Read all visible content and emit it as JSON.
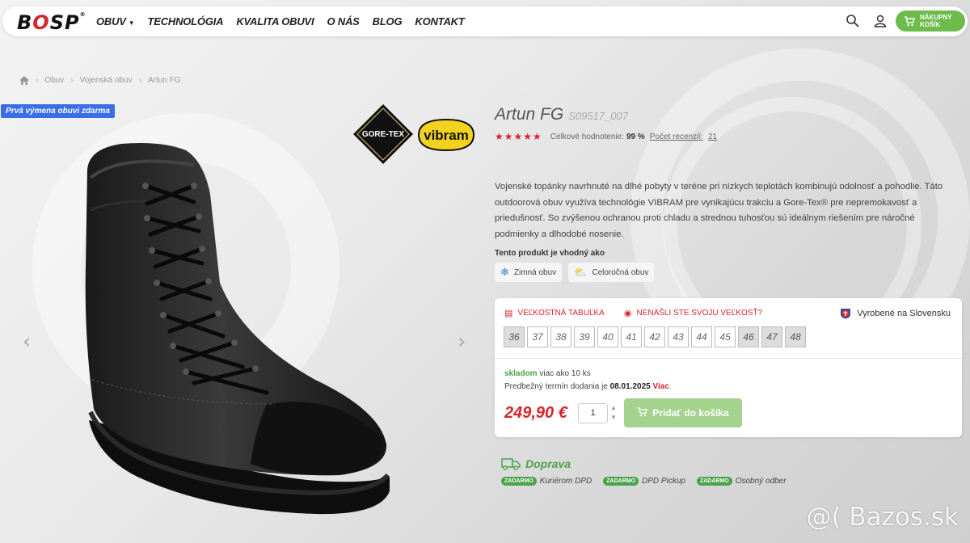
{
  "header": {
    "logo": "BOSP",
    "nav": [
      "OBUV",
      "TECHNOLÓGIA",
      "KVALITA OBUVI",
      "O NÁS",
      "BLOG",
      "KONTAKT"
    ],
    "cart_label_line1": "NÁKUPNÝ",
    "cart_label_line2": "KOŠÍK",
    "icons": [
      "search-icon",
      "user-icon",
      "cart-icon"
    ]
  },
  "breadcrumb": [
    "Obuv",
    "Vojenská obuv",
    "Artun FG"
  ],
  "promo_badge": "Prvá výmena obuvi zdarma",
  "brands": {
    "goretex": "GORE-TEX",
    "vibram": "vibram"
  },
  "product": {
    "name": "Artun FG",
    "code": "S09517_007",
    "rating_stars": 5,
    "rating_label": "Celkové hodnotenie:",
    "rating_value": "99 %",
    "reviews_label": "Počet recenzií:",
    "reviews_count": "21",
    "description": "Vojenské topánky navrhnuté na dlhé pobyty v teréne pri nízkych teplotách kombinujú odolnosť a pohodlie. Táto outdoorová obuv využíva technológie VIBRAM pre vynikajúcu trakciu a Gore-Tex® pre nepremokavosť a priedušnosť. So zvýšenou ochranou proti chladu a strednou tuhosťou sú ideálnym riešením pre náročné podmienky a dlhodobé nosenie.",
    "suitable_title": "Tento produkt je vhodný ako",
    "suitable": [
      "Zimná obuv",
      "Celoročná obuv"
    ]
  },
  "buybox": {
    "size_table": "VEĽKOSTNÁ TABUĽKA",
    "find_size": "NENAŠLI STE SVOJU VEĽKOSŤ?",
    "made_in": "Vyrobené na Slovensku",
    "sizes": [
      {
        "v": "36",
        "available": false
      },
      {
        "v": "37",
        "available": true
      },
      {
        "v": "38",
        "available": true
      },
      {
        "v": "39",
        "available": true
      },
      {
        "v": "40",
        "available": true
      },
      {
        "v": "41",
        "available": true
      },
      {
        "v": "42",
        "available": true
      },
      {
        "v": "43",
        "available": true
      },
      {
        "v": "44",
        "available": true
      },
      {
        "v": "45",
        "available": true
      },
      {
        "v": "46",
        "available": false
      },
      {
        "v": "47",
        "available": false
      },
      {
        "v": "48",
        "available": false
      }
    ],
    "stock_status": "skladom",
    "stock_qty": "viac ako 10 ks",
    "delivery_label": "Predbežný termín dodania je",
    "delivery_date": "08.01.2025",
    "delivery_more": "Viac",
    "price": "249,90 €",
    "quantity": "1",
    "add_to_cart": "Pridať do košíka"
  },
  "shipping": {
    "title": "Doprava",
    "badge": "ZADARMO",
    "options": [
      "Kuriérom DPD",
      "DPD Pickup",
      "Osobný odber"
    ]
  },
  "watermark": "@( Bazos.sk",
  "colors": {
    "accent_red": "#d9242b",
    "green": "#6dbb4a",
    "promo_blue": "#3a6ee8"
  }
}
